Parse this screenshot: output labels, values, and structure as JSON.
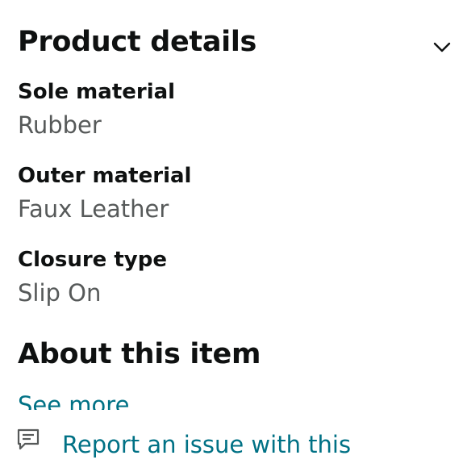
{
  "product_details": {
    "title": "Product details",
    "items": [
      {
        "label": "Sole material",
        "value": "Rubber"
      },
      {
        "label": "Outer material",
        "value": "Faux Leather"
      },
      {
        "label": "Closure type",
        "value": "Slip On"
      }
    ]
  },
  "about": {
    "title": "About this item",
    "see_more": "See more"
  },
  "report": {
    "label": "Report an issue with this"
  },
  "icons": {
    "toggle": "chevron-down-icon",
    "report": "feedback-icon"
  },
  "colors": {
    "heading": "#0f1111",
    "value": "#565959",
    "link": "#007185"
  }
}
